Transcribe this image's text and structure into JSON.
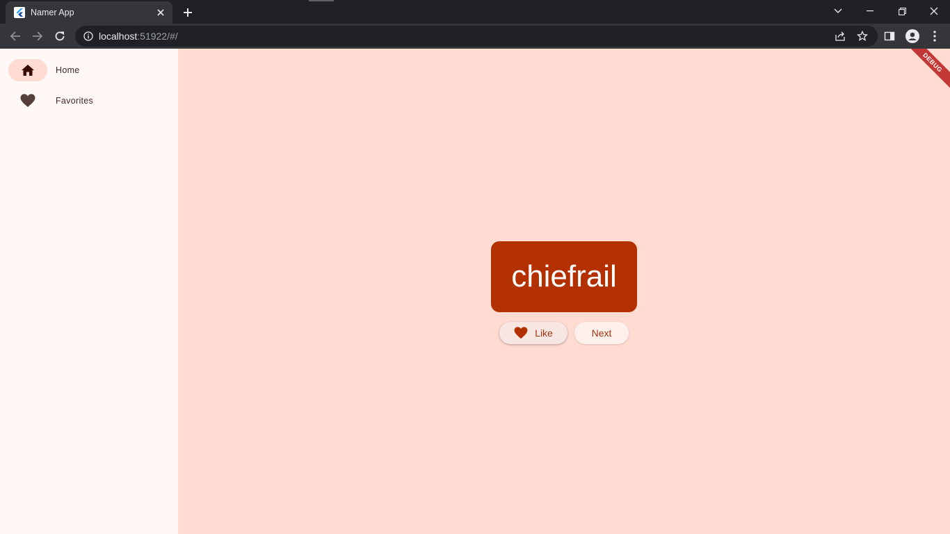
{
  "browser": {
    "tab_title": "Namer App",
    "url_host": "localhost",
    "url_rest": ":51922/#/"
  },
  "rail": {
    "items": [
      {
        "label": "Home",
        "icon": "home-icon",
        "selected": true
      },
      {
        "label": "Favorites",
        "icon": "heart-icon",
        "selected": false
      }
    ]
  },
  "main": {
    "word": "chiefrail",
    "like_label": "Like",
    "next_label": "Next",
    "debug_label": "DEBUG"
  },
  "colors": {
    "primary": "#b33000",
    "background": "#ffdbd1",
    "rail_indicator": "#ffdbd1"
  }
}
